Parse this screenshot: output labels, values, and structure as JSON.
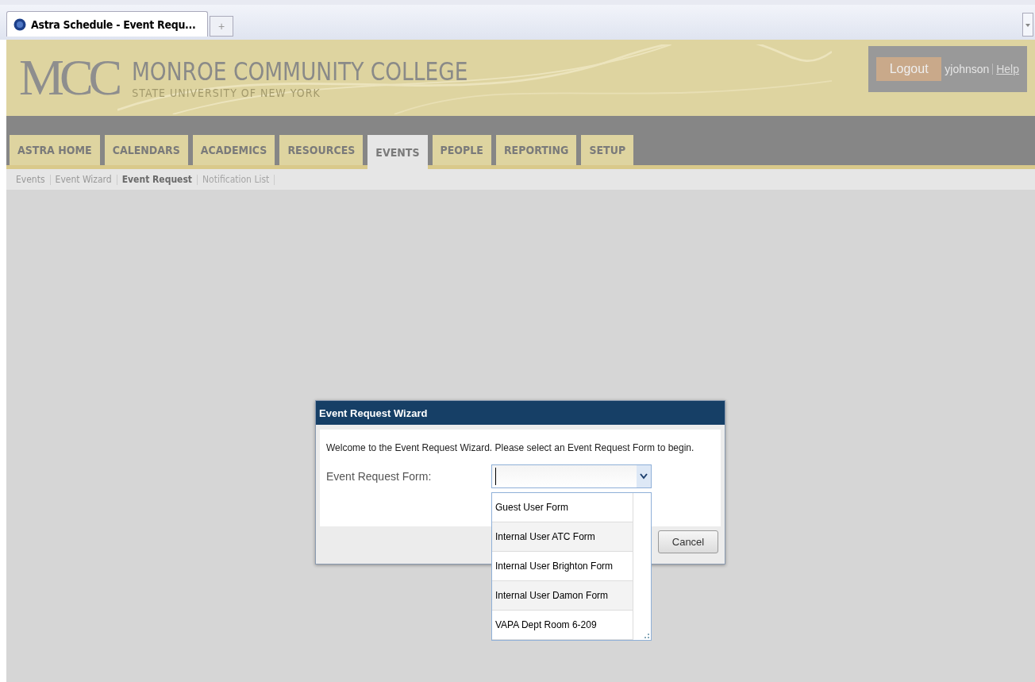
{
  "browser": {
    "tab_title": "Astra Schedule - Event Requ...",
    "new_tab": "+"
  },
  "header": {
    "logo": "MCC",
    "college": "MONROE COMMUNITY COLLEGE",
    "subtitle": "STATE UNIVERSITY OF NEW YORK",
    "logout": "Logout",
    "user": "yjohnson",
    "help": "Help"
  },
  "tabs": [
    {
      "label": "ASTRA HOME",
      "selected": false
    },
    {
      "label": "CALENDARS",
      "selected": false
    },
    {
      "label": "ACADEMICS",
      "selected": false
    },
    {
      "label": "RESOURCES",
      "selected": false
    },
    {
      "label": "EVENTS",
      "selected": true
    },
    {
      "label": "PEOPLE",
      "selected": false
    },
    {
      "label": "REPORTING",
      "selected": false
    },
    {
      "label": "SETUP",
      "selected": false
    }
  ],
  "subnav": [
    {
      "label": "Events",
      "selected": false,
      "disabled": false
    },
    {
      "label": "Event Wizard",
      "selected": false,
      "disabled": false
    },
    {
      "label": "Event Request",
      "selected": true,
      "disabled": false
    },
    {
      "label": "Notification List",
      "selected": false,
      "disabled": true
    }
  ],
  "dialog": {
    "title": "Event Request Wizard",
    "message": "Welcome to the Event Request Wizard. Please select an Event Request Form to begin.",
    "field_label": "Event Request Form:",
    "cancel": "Cancel",
    "options": [
      "Guest User Form",
      "Internal User ATC Form",
      "Internal User Brighton Form",
      "Internal User Damon Form",
      "VAPA Dept Room 6-209"
    ]
  }
}
